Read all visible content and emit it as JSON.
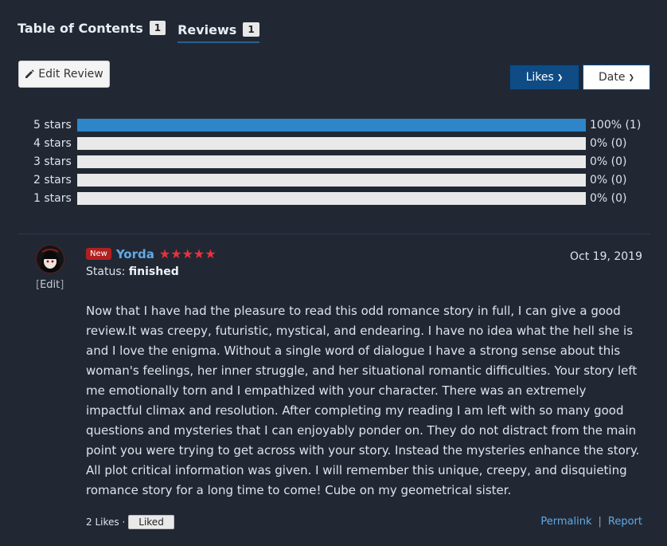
{
  "tabs": [
    {
      "label": "Table of Contents",
      "count": "1"
    },
    {
      "label": "Reviews",
      "count": "1"
    }
  ],
  "toolbar": {
    "edit_review": "Edit Review",
    "sort_likes": "Likes",
    "sort_date": "Date"
  },
  "ratings": [
    {
      "label": "5 stars",
      "fraction": 1.0,
      "text": "100% (1)"
    },
    {
      "label": "4 stars",
      "fraction": 0.0,
      "text": "0% (0)"
    },
    {
      "label": "3 stars",
      "fraction": 0.0,
      "text": "0% (0)"
    },
    {
      "label": "2 stars",
      "fraction": 0.0,
      "text": "0% (0)"
    },
    {
      "label": "1 stars",
      "fraction": 0.0,
      "text": "0% (0)"
    }
  ],
  "review": {
    "edit_label": "Edit",
    "badge": "New",
    "username": "Yorda",
    "stars": "★★★★★",
    "date": "Oct 19, 2019",
    "status_label": "Status:",
    "status_value": "finished",
    "body": "Now that I have had the pleasure to read this odd romance story in full, I can give a good review.It was creepy, futuristic, mystical, and endearing. I have no idea what the hell she is and I love the enigma. Without a single word of dialogue I have a strong sense about this woman's feelings, her inner struggle, and her situational romantic difficulties. Your story left me emotionally torn and I empathized with your character. There was an extremely impactful climax and resolution. After completing my reading I am left with so many good questions and mysteries that I can enjoyably ponder on. They do not distract from the main point you were trying to get across with your story. Instead the mysteries enhance the story. All plot critical information was given. I will remember this  unique, creepy, and disquieting romance story for a long time to come! Cube on my geometrical sister.",
    "likes_text": "2 Likes ·",
    "liked_label": "Liked",
    "permalink": "Permalink",
    "report": "Report"
  },
  "colors": {
    "background": "#212834",
    "bar_fill": "#2e86c9",
    "accent_link": "#62a9e6",
    "star": "#e8323c"
  }
}
